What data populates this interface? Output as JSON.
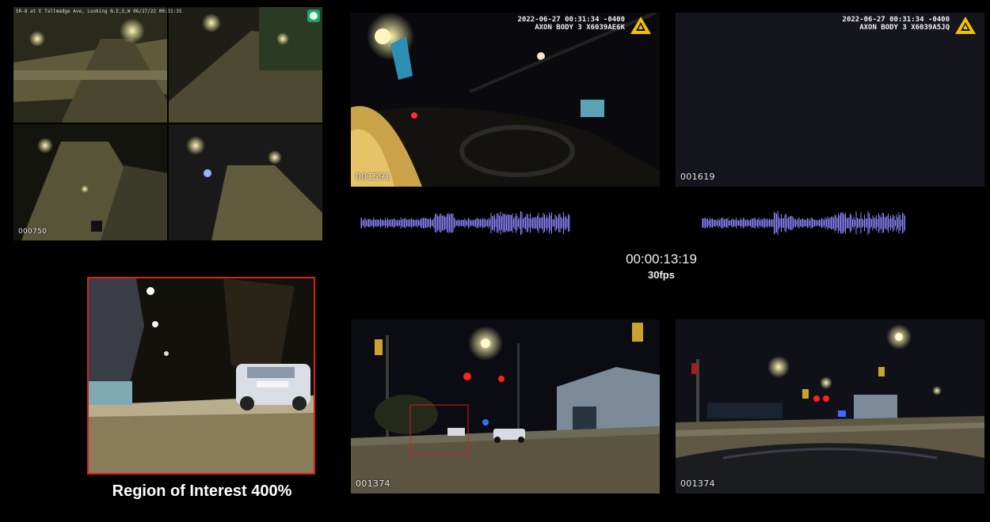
{
  "traffic_cam": {
    "caption": "SR-8 at E Tallmadge Ave, Looking N.E,S,W 06/27/22 00:31:35",
    "frame": "000750",
    "status_icon": "green-circle-status-icon"
  },
  "bodycam_1": {
    "stamp": "2022-06-27 00:31:34 -0400\nAXON BODY 3 X6039AE6K",
    "frame": "001591",
    "logo": "axon-logo-icon"
  },
  "bodycam_2": {
    "stamp": "2022-06-27 00:31:34 -0400\nAXON BODY 3 X6039A5JQ",
    "frame": "001619",
    "logo": "axon-logo-icon"
  },
  "timeline": {
    "timecode": "00:00:13:19",
    "fps": "30fps"
  },
  "roi": {
    "caption": "Region of Interest 400%"
  },
  "dashcam_1": {
    "frame": "001374"
  },
  "dashcam_2": {
    "frame": "001374"
  },
  "colors": {
    "background": "#000000",
    "roi_border": "#d81e1e",
    "waveform": "#8f86ff",
    "axon_yellow": "#f2c200"
  }
}
